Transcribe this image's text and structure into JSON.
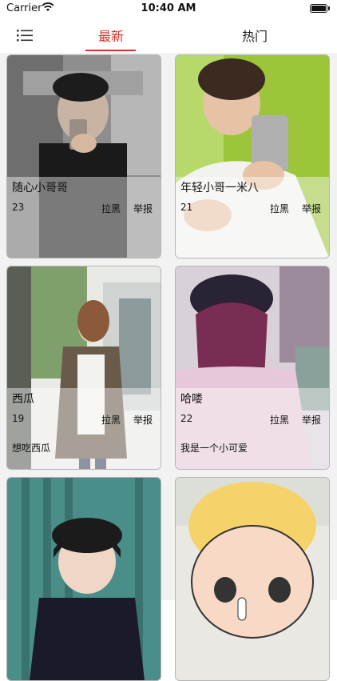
{
  "status_bar": {
    "carrier": "Carrier",
    "time": "10:40 AM"
  },
  "nav": {
    "tab_latest": "最新",
    "tab_hot": "热门"
  },
  "cards": [
    {
      "name": "随心小哥哥",
      "age": "23",
      "block": "拉黑",
      "report": "举报",
      "bio": ""
    },
    {
      "name": "年轻小哥一米八",
      "age": "21",
      "block": "拉黑",
      "report": "举报",
      "bio": ""
    },
    {
      "name": "西瓜",
      "age": "19",
      "block": "拉黑",
      "report": "举报",
      "bio": "想吃西瓜"
    },
    {
      "name": "哈喽",
      "age": "22",
      "block": "拉黑",
      "report": "举报",
      "bio": "我是一个小可爱"
    },
    {
      "name": "",
      "age": "",
      "block": "",
      "report": "",
      "bio": ""
    },
    {
      "name": "",
      "age": "",
      "block": "",
      "report": "",
      "bio": ""
    }
  ],
  "colors": {
    "accent": "#d8312b"
  }
}
